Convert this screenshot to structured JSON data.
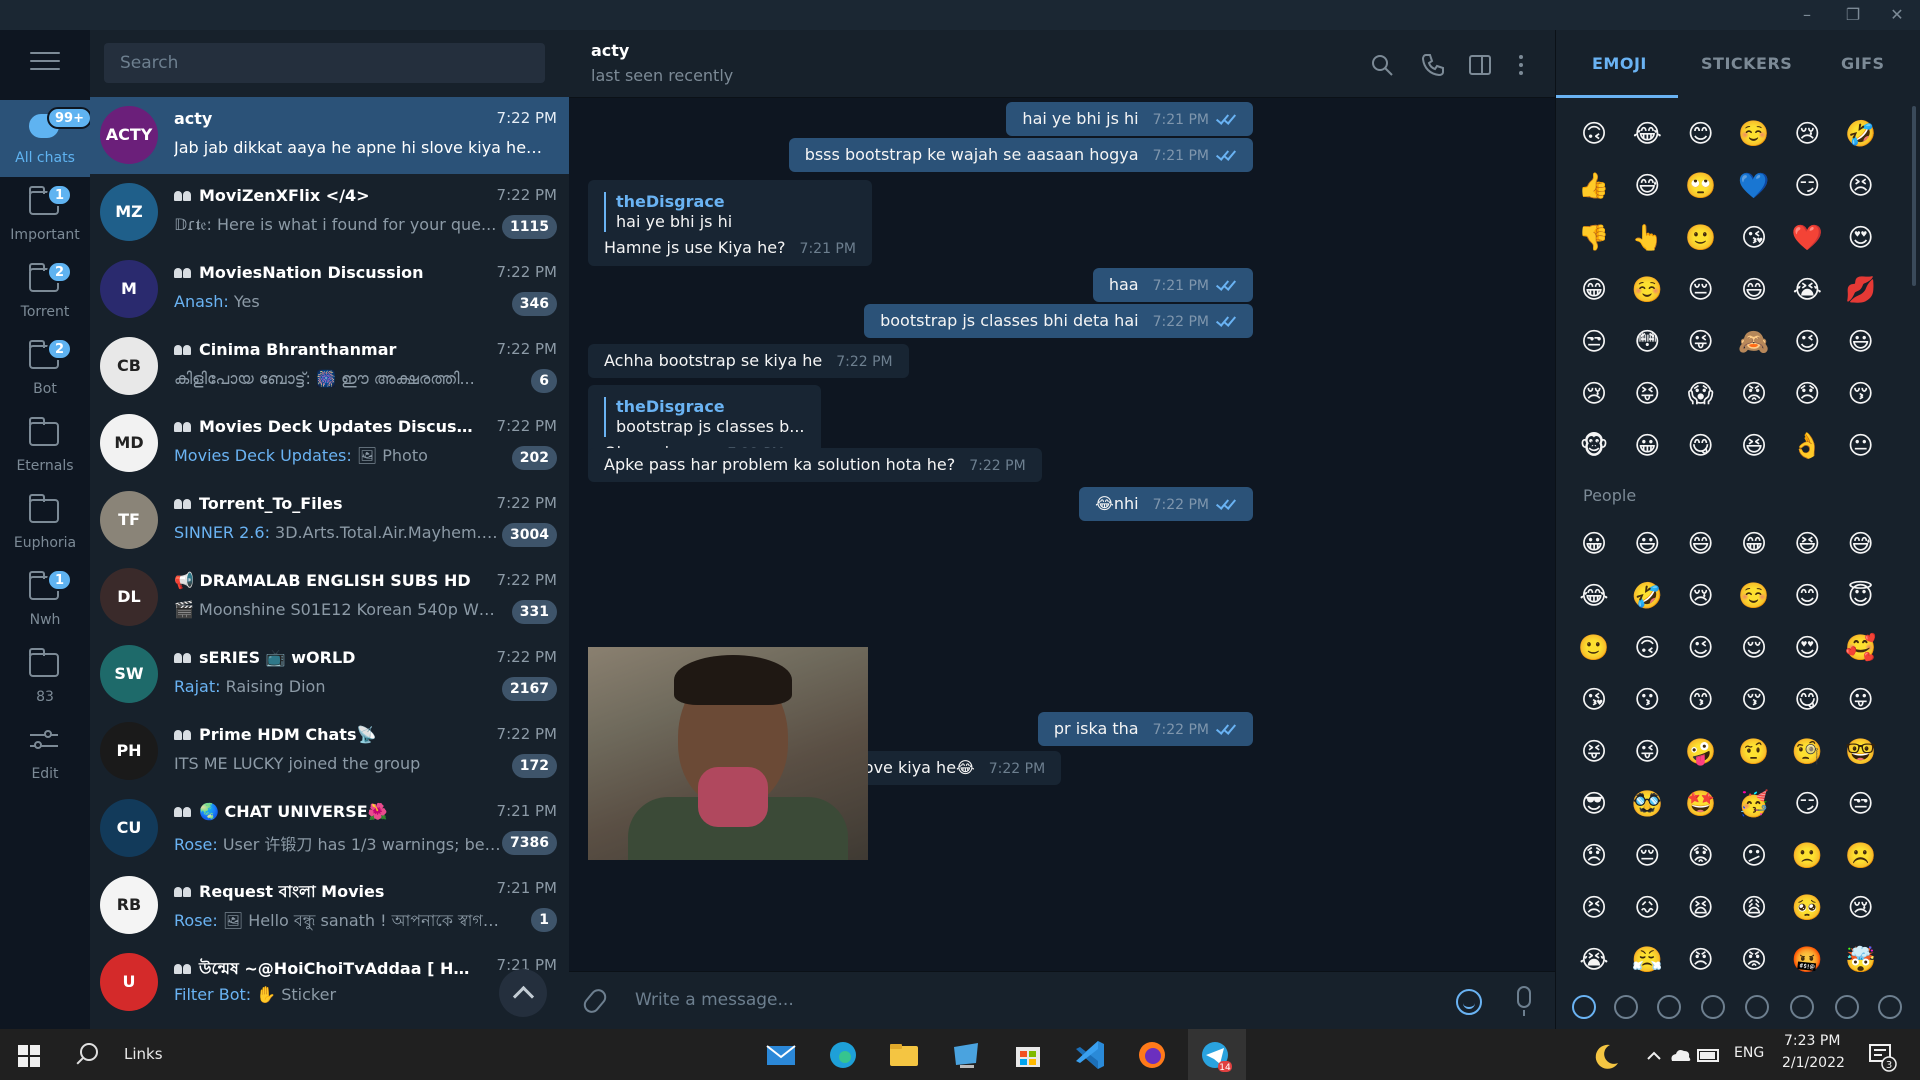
{
  "window": {
    "minimize": "–",
    "maximize": "❐",
    "close": "✕"
  },
  "folders": [
    {
      "label": "All chats",
      "badge": "99+",
      "icon": "chat-bubbles-icon"
    },
    {
      "label": "Important",
      "badge": "1",
      "icon": "folder-icon"
    },
    {
      "label": "Torrent",
      "badge": "2",
      "icon": "folder-icon"
    },
    {
      "label": "Bot",
      "badge": "2",
      "icon": "folder-icon"
    },
    {
      "label": "Eternals",
      "badge": "",
      "icon": "folder-icon"
    },
    {
      "label": "Euphoria",
      "badge": "",
      "icon": "folder-icon"
    },
    {
      "label": "Nwh",
      "badge": "1",
      "icon": "folder-icon"
    },
    {
      "label": "83",
      "badge": "",
      "icon": "folder-icon"
    },
    {
      "label": "Edit",
      "badge": "",
      "icon": "sliders-icon"
    }
  ],
  "search": {
    "placeholder": "Search"
  },
  "chats": [
    {
      "name": "acty",
      "group": false,
      "time": "7:22 PM",
      "sender": "",
      "preview": "Jab jab dikkat aaya he apne hi slove kiya he😂",
      "badge": "",
      "avatar_text": "ACTY",
      "avatar_color": "#6b1f7a"
    },
    {
      "name": "MoviZenXFlix </4>",
      "group": true,
      "time": "7:22 PM",
      "sender": "",
      "preview": "𝔻ɾ𝖙𝔢: Here is what i found for your que...",
      "badge": "1115",
      "avatar_text": "MZ",
      "avatar_color": "#1f5f8a"
    },
    {
      "name": "MoviesNation Discussion",
      "group": true,
      "time": "7:22 PM",
      "sender": "Anash: ",
      "preview": "Yes",
      "badge": "346",
      "avatar_text": "M",
      "avatar_color": "#2a2a6e"
    },
    {
      "name": "Cinima Bhranthanmar",
      "group": true,
      "time": "7:22 PM",
      "sender": "",
      "preview": "കിളിപോയ ബോട്ട്: 🎆 ഈ അക്ഷരത്തി...",
      "badge": "6",
      "avatar_text": "CB",
      "avatar_color": "#e8e8e8"
    },
    {
      "name": "Movies Deck Updates Discussion",
      "group": true,
      "time": "7:22 PM",
      "sender": "Movies Deck Updates: ",
      "preview": "🖼 Photo",
      "badge": "202",
      "avatar_text": "MD",
      "avatar_color": "#f2f2f2"
    },
    {
      "name": "Torrent_To_Files",
      "group": true,
      "time": "7:22 PM",
      "sender": "SINNER 2.6: ",
      "preview": "3D.Arts.Total.Air.Mayhem.194...",
      "badge": "3004",
      "avatar_text": "TF",
      "avatar_color": "#8a8478"
    },
    {
      "name": "📢 DRAMALAB ENGLISH SUBS HD",
      "group": false,
      "time": "7:22 PM",
      "sender": "",
      "preview": "🎬 Moonshine S01E12 Korean 540p WEB-D...",
      "badge": "331",
      "avatar_text": "DL",
      "avatar_color": "#3a2a2a"
    },
    {
      "name": "sERIES 📺 wORLD",
      "group": true,
      "time": "7:22 PM",
      "sender": "Rajat: ",
      "preview": "Raising Dion",
      "badge": "2167",
      "avatar_text": "SW",
      "avatar_color": "#1e6a6a"
    },
    {
      "name": "Prime HDM Chats📡",
      "group": true,
      "time": "7:22 PM",
      "sender": "",
      "preview": "ITS ME LUCKY joined the group",
      "badge": "172",
      "avatar_text": "PH",
      "avatar_color": "#1a1a1a"
    },
    {
      "name": "🌏 CHAT UNIVERSE🌺",
      "group": true,
      "time": "7:21 PM",
      "sender": "Rose: ",
      "preview": "User 许锻刀 has 1/3 warnings; be ca...",
      "badge": "7386",
      "avatar_text": "CU",
      "avatar_color": "#123a5a"
    },
    {
      "name": "Request বাংলা Movies",
      "group": true,
      "time": "7:21 PM",
      "sender": "Rose: ",
      "preview": "🖼 Hello বন্ধু sanath ! আপনাকে স্বাগত জা...",
      "badge": "1",
      "avatar_text": "RB",
      "avatar_color": "#f4f4f4"
    },
    {
      "name": "উন্মেষ ~@HoiChoiTvAddaa [ HOICH...",
      "group": true,
      "time": "7:21 PM",
      "sender": "Filter Bot: ",
      "preview": "✋ Sticker",
      "badge": "",
      "avatar_text": "U",
      "avatar_color": "#d42a2a"
    }
  ],
  "chat": {
    "name": "acty",
    "status": "last seen recently"
  },
  "messages": [
    {
      "dir": "out",
      "text": "hai ye bhi js hi",
      "time": "7:21 PM"
    },
    {
      "dir": "out",
      "text": "bsss bootstrap ke wajah se aasaan hogya",
      "time": "7:21 PM"
    },
    {
      "dir": "in",
      "reply_name": "theDisgrace",
      "reply_text": "hai ye bhi js hi",
      "text": "Hamne js use Kiya he?",
      "time": "7:21 PM"
    },
    {
      "dir": "out",
      "text": "haa",
      "time": "7:21 PM"
    },
    {
      "dir": "out",
      "text": "bootstrap js classes bhi deta hai",
      "time": "7:22 PM"
    },
    {
      "dir": "in",
      "text": "Achha bootstrap se kiya he",
      "time": "7:22 PM"
    },
    {
      "dir": "in",
      "reply_name": "theDisgrace",
      "reply_text": "bootstrap js classes b...",
      "text": "Ok samj gaya",
      "time": "7:22 PM"
    },
    {
      "dir": "in",
      "text": "Apke pass har problem ka solution hota he?",
      "time": "7:22 PM"
    },
    {
      "dir": "out",
      "text": "😂nhi",
      "time": "7:22 PM"
    },
    {
      "dir": "out",
      "text": "pr iska tha",
      "time": "7:22 PM"
    },
    {
      "dir": "in",
      "text": "Jab jab dikkat aaya he apne hi slove kiya he😂",
      "time": "7:22 PM"
    }
  ],
  "composer": {
    "placeholder": "Write a message..."
  },
  "emoji_panel": {
    "tabs": [
      "EMOJI",
      "STICKERS",
      "GIFS"
    ],
    "recent": [
      "🙃",
      "😂",
      "😊",
      "☺️",
      "😢",
      "🤣",
      "👍",
      "😅",
      "🙄",
      "💙",
      "😏",
      "😣",
      "👎",
      "👆",
      "🙂",
      "😘",
      "❤️",
      "😍",
      "😁",
      "☺️",
      "😔",
      "😄",
      "😭",
      "💋",
      "😒",
      "😳",
      "😜",
      "🙈",
      "😉",
      "😃",
      "😢",
      "😝",
      "😱",
      "😡",
      "😞",
      "😚",
      "🐵",
      "😀",
      "😋",
      "😆",
      "👌",
      "😐"
    ],
    "section": "People",
    "people": [
      "😀",
      "😃",
      "😄",
      "😁",
      "😆",
      "😅",
      "😂",
      "🤣",
      "😢",
      "☺️",
      "😊",
      "😇",
      "🙂",
      "🙃",
      "😉",
      "😌",
      "😍",
      "🥰",
      "😘",
      "😗",
      "😙",
      "😚",
      "😋",
      "😛",
      "😝",
      "😜",
      "🤪",
      "🤨",
      "🧐",
      "🤓",
      "😎",
      "🥸",
      "🤩",
      "🥳",
      "😏",
      "😒",
      "😞",
      "😔",
      "😟",
      "😕",
      "🙁",
      "☹️",
      "😣",
      "😖",
      "😫",
      "😩",
      "🥺",
      "😢",
      "😭",
      "😤",
      "😠",
      "😡",
      "🤬",
      "🤯"
    ]
  },
  "taskbar": {
    "search_label": "Links",
    "tray_lang": "ENG",
    "clock_time": "7:23 PM",
    "clock_date": "2/1/2022",
    "notif_count": "3",
    "telegram_badge": "14"
  }
}
